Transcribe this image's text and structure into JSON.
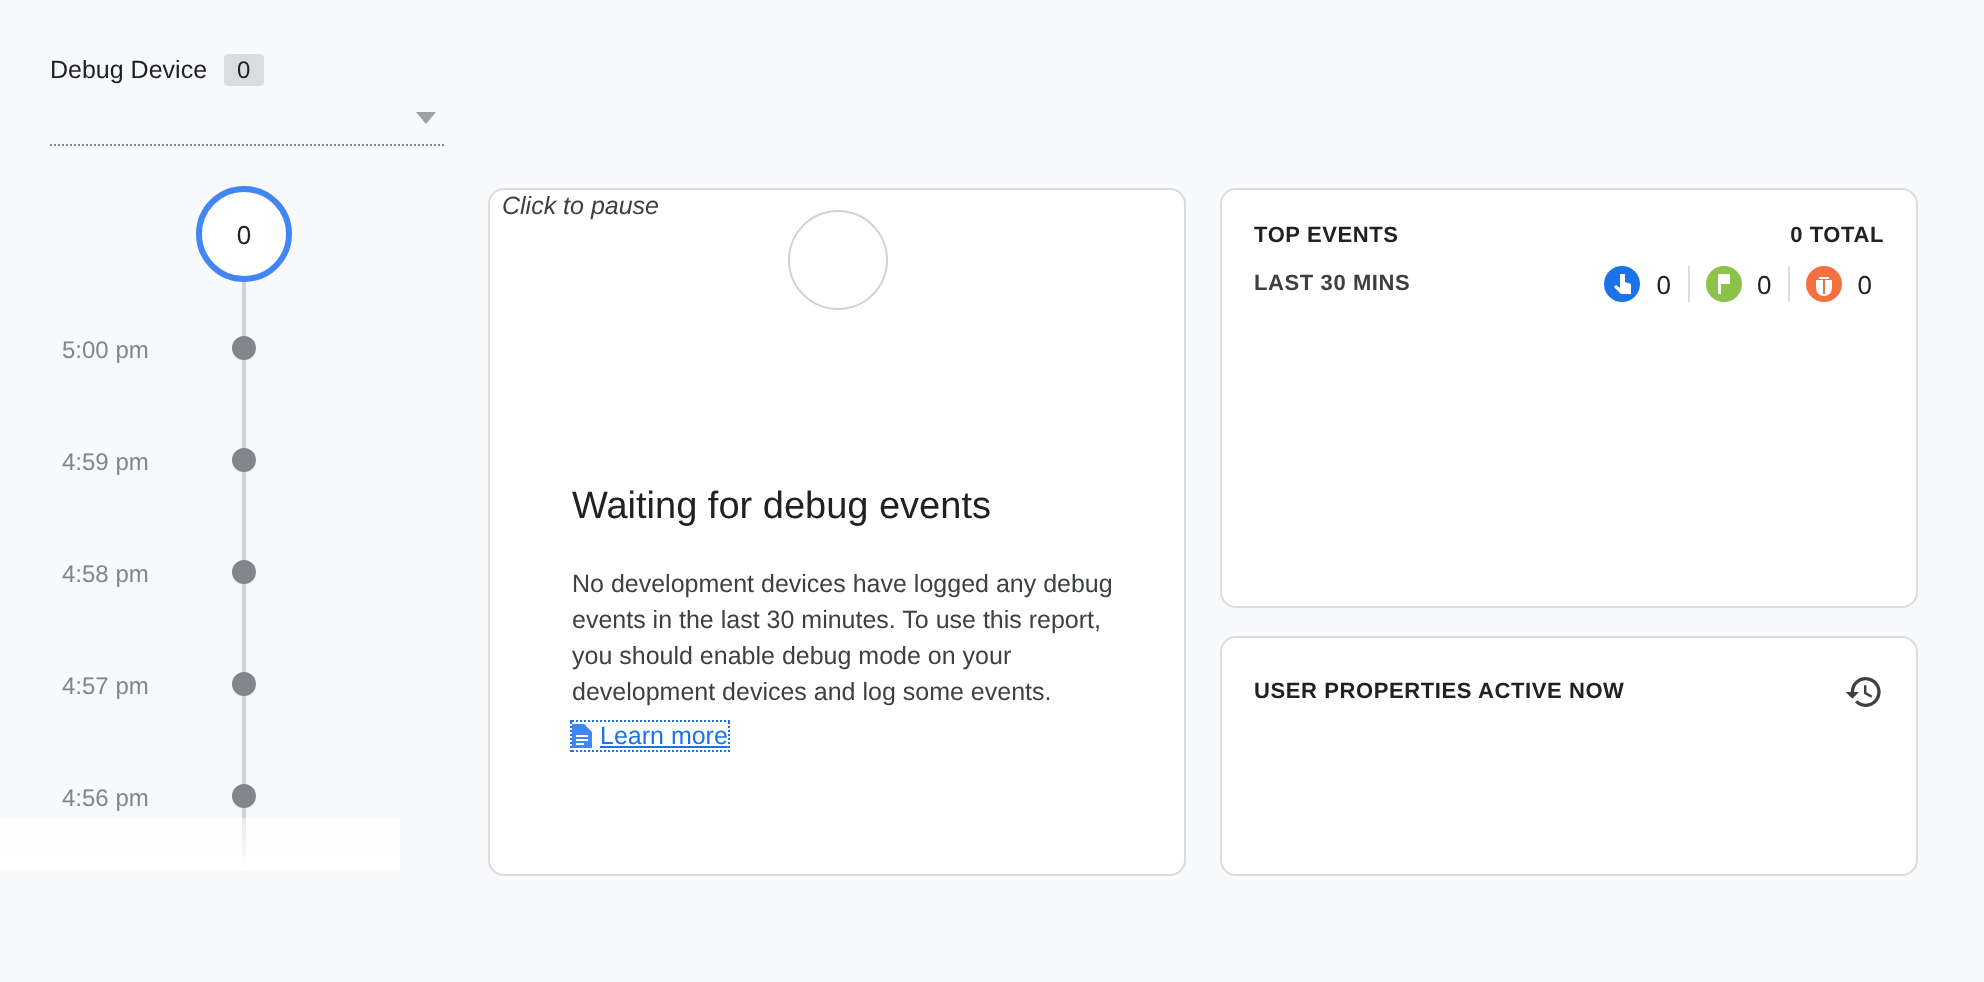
{
  "device_selector": {
    "label": "Debug Device",
    "count": "0"
  },
  "timeline": {
    "current": "0",
    "times": [
      "5:00 pm",
      "4:59 pm",
      "4:58 pm",
      "4:57 pm",
      "4:56 pm"
    ]
  },
  "stream_card": {
    "pause_hint": "Click to pause",
    "heading": "Waiting for debug events",
    "message": "No development devices have logged any debug events in the last 30 minutes. To use this report, you should enable debug mode on your development devices and log some events.",
    "link": "Learn more"
  },
  "top_events": {
    "title": "TOP EVENTS",
    "total": "0 TOTAL",
    "period": "LAST 30 MINS",
    "counters": [
      {
        "kind": "touch",
        "color": "#1a73e8",
        "value": "0"
      },
      {
        "kind": "flag",
        "color": "#8bc34a",
        "value": "0"
      },
      {
        "kind": "bug",
        "color": "#f4703f",
        "value": "0"
      }
    ]
  },
  "user_properties": {
    "title": "USER PROPERTIES ACTIVE NOW"
  }
}
